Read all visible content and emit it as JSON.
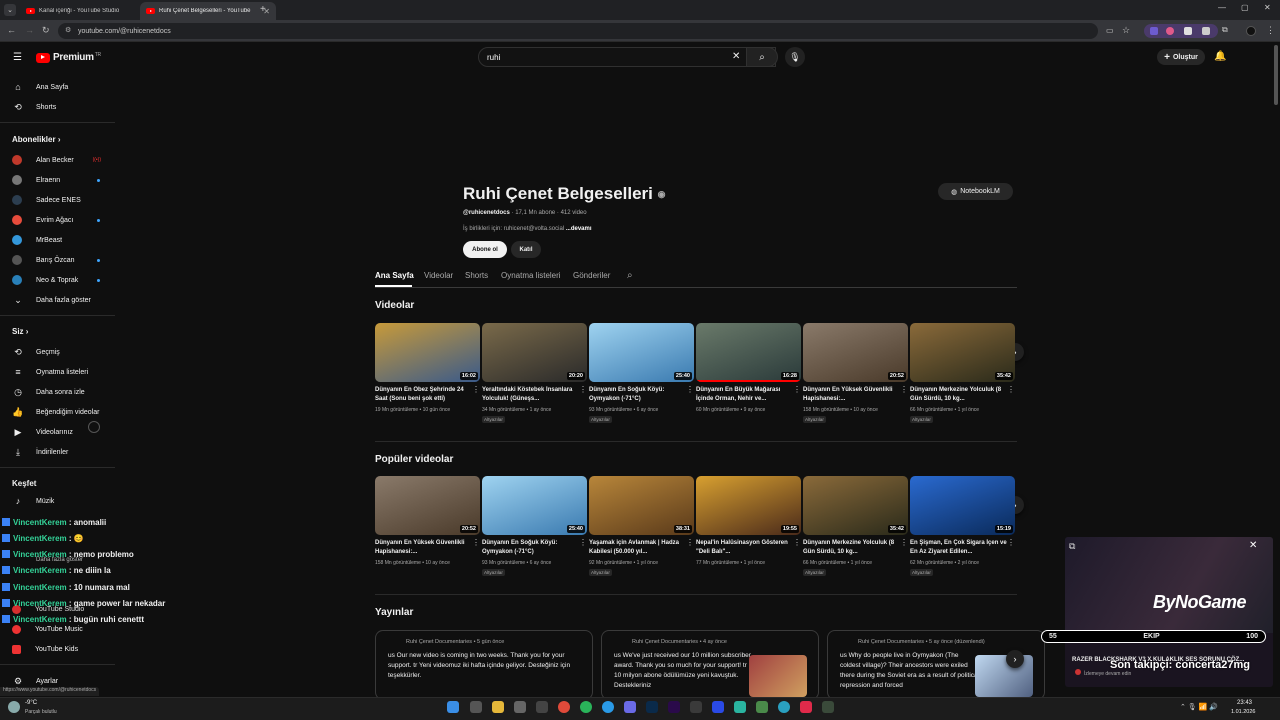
{
  "browser": {
    "tabs": [
      {
        "title": "Kanal içeriği - YouTube Studio"
      },
      {
        "title": "Ruhi Çenet Belgeselleri - YouTube"
      }
    ],
    "url": "youtube.com/@ruhicenetdocs"
  },
  "masthead": {
    "logo": "Premium",
    "region": "TR",
    "search_query": "ruhi",
    "create_label": "Oluştur"
  },
  "sidebar": {
    "main": [
      {
        "label": "Ana Sayfa",
        "icon": "home-icon"
      },
      {
        "label": "Shorts",
        "icon": "shorts-icon"
      }
    ],
    "subs_title": "Abonelikler",
    "subs": [
      {
        "label": "Alan Becker",
        "color": "#c0392b",
        "live": true
      },
      {
        "label": "Elraenn",
        "color": "#555555"
      },
      {
        "label": "Sadece ENES",
        "color": "#2c3e50"
      },
      {
        "label": "Evrim Ağacı",
        "color": "#e74c3c"
      },
      {
        "label": "MrBeast",
        "color": "#3498db"
      },
      {
        "label": "Barış Özcan",
        "color": "#444444"
      },
      {
        "label": "Neo & Toprak",
        "color": "#2980b9"
      }
    ],
    "more_subs": "Daha fazla göster",
    "you_title": "Siz",
    "you": [
      {
        "label": "Geçmiş",
        "icon": "history-icon"
      },
      {
        "label": "Oynatma listeleri",
        "icon": "playlist-icon"
      },
      {
        "label": "Daha sonra izle",
        "icon": "watch-later-icon"
      },
      {
        "label": "Beğendiğim videolar",
        "icon": "like-icon"
      },
      {
        "label": "Videolarınız",
        "icon": "your-videos-icon"
      },
      {
        "label": "İndirilenler",
        "icon": "download-icon"
      }
    ],
    "explore_title": "Keşfet",
    "explore": [
      {
        "label": "Müzik",
        "icon": "music-icon"
      }
    ],
    "more_from": [
      {
        "label": "YouTube Studio"
      },
      {
        "label": "YouTube Music"
      },
      {
        "label": "YouTube Kids"
      }
    ],
    "settings": "Ayarlar",
    "hidden_more": "Daha fazla göster"
  },
  "channel": {
    "name": "Ruhi Çenet Belgeselleri",
    "handle": "@ruhicenetdocs",
    "stats": "· 17,1 Mn abone · 412 video",
    "desc": "İş birlikleri için: ruhicenet@volta.social",
    "more": "...devamı",
    "subscribe": "Abone ol",
    "join": "Katıl",
    "notebook": "NotebookLM",
    "tabs": [
      "Ana Sayfa",
      "Videolar",
      "Shorts",
      "Oynatma listeleri",
      "Gönderiler"
    ]
  },
  "sections": {
    "videos": "Videolar",
    "popular": "Popüler videolar",
    "posts": "Yayınlar"
  },
  "videos": [
    {
      "title": "Dünyanın En Obez Şehrinde 24 Saat (Sonu beni şok etti)",
      "meta": "19 Mn görüntüleme • 10 gün önce",
      "dur": "16:02",
      "badge": "",
      "c1": "#c79a3a",
      "c2": "#3a5a8a",
      "progress": 0
    },
    {
      "title": "Yeraltındaki Köstebek İnsanlara Yolculuk! (Güneşs...",
      "meta": "34 Mn görüntüleme • 1 ay önce",
      "dur": "20:20",
      "badge": "Altyazılar",
      "c1": "#7a6a4a",
      "c2": "#2a2a2a",
      "progress": 0
    },
    {
      "title": "Dünyanın En Soğuk Köyü: Oymyakon (-71°C)",
      "meta": "93 Mn görüntüleme • 6 ay önce",
      "dur": "25:40",
      "badge": "Altyazılar",
      "c1": "#9fd3f0",
      "c2": "#3a7ab0",
      "progress": 0
    },
    {
      "title": "Dünyanın En Büyük Mağarası İçinde Orman, Nehir ve...",
      "meta": "60 Mn görüntüleme • 9 ay önce",
      "dur": "16:28",
      "badge": "",
      "c1": "#6a7a6a",
      "c2": "#2a3a3a",
      "progress": 100
    },
    {
      "title": "Dünyanın En Yüksek Güvenlikli Hapishanesi:...",
      "meta": "158 Mn görüntüleme • 10 ay önce",
      "dur": "20:52",
      "badge": "Altyazılar",
      "c1": "#8a7a6a",
      "c2": "#4a3a2a",
      "progress": 0
    },
    {
      "title": "Dünyanın Merkezine Yolculuk (8 Gün Sürdü, 10 kg...",
      "meta": "66 Mn görüntüleme • 1 yıl önce",
      "dur": "35:42",
      "badge": "Altyazılar",
      "c1": "#8a6a3a",
      "c2": "#2a2a1a",
      "progress": 0
    }
  ],
  "popular": [
    {
      "title": "Dünyanın En Yüksek Güvenlikli Hapishanesi:...",
      "meta": "158 Mn görüntüleme • 10 ay önce",
      "dur": "20:52",
      "badge": "",
      "c1": "#8a7a6a",
      "c2": "#4a3a2a",
      "progress": 0
    },
    {
      "title": "Dünyanın En Soğuk Köyü: Oymyakon (-71°C)",
      "meta": "93 Mn görüntüleme • 6 ay önce",
      "dur": "25:40",
      "badge": "Altyazılar",
      "c1": "#9fd3f0",
      "c2": "#3a7ab0",
      "progress": 0
    },
    {
      "title": "Yaşamak için Avlanmak | Hadza Kabilesi (50.000 yıl...",
      "meta": "92 Mn görüntüleme • 1 yıl önce",
      "dur": "38:31",
      "badge": "Altyazılar",
      "c1": "#b8863a",
      "c2": "#5a3a1a",
      "progress": 0
    },
    {
      "title": "Nepal'in Halüsinasyon Gösteren \"Deli Balı\"...",
      "meta": "77 Mn görüntüleme • 1 yıl önce",
      "dur": "19:55",
      "badge": "",
      "c1": "#d8a030",
      "c2": "#4a2a1a",
      "progress": 0
    },
    {
      "title": "Dünyanın Merkezine Yolculuk (8 Gün Sürdü, 10 kg...",
      "meta": "66 Mn görüntüleme • 1 yıl önce",
      "dur": "35:42",
      "badge": "Altyazılar",
      "c1": "#8a6a3a",
      "c2": "#2a2a1a",
      "progress": 0
    },
    {
      "title": "En Şişman, En Çok Sigara İçen ve En Az Ziyaret Edilen...",
      "meta": "62 Mn görüntüleme • 2 yıl önce",
      "dur": "15:19",
      "badge": "Altyazılar",
      "c1": "#2a6ad0",
      "c2": "#0a2a5a",
      "progress": 0
    }
  ],
  "posts": [
    {
      "author": "Ruhi Çenet Documentaries",
      "when": "5 gün önce",
      "text": "us Our new video is coming in two weeks. Thank you for your support. tr Yeni videomuz iki hafta içinde geliyor. Desteğiniz için teşekkürler."
    },
    {
      "author": "Ruhi Çenet Documentaries",
      "when": "4 ay önce",
      "text": "us We've just received our 10 million subscriber award. Thank you so much for your support! tr 10 milyon abone ödülümüze yeni kavuştuk. Destekleriniz"
    },
    {
      "author": "Ruhi Çenet Documentaries",
      "when": "5 ay önce (düzenlendi)",
      "text": "us Why do people live in Oymyakon (The coldest village)? Their ancestors were exiled there during the Soviet era as a result of political repression and forced"
    }
  ],
  "chat": [
    {
      "name": "VincentKerem",
      "msg": ": anomalii"
    },
    {
      "name": "VincentKerem",
      "msg": ": 😊"
    },
    {
      "name": "VincentKerem",
      "msg": ": nemo problemo"
    },
    {
      "name": "VincentKerem",
      "msg": ": ne diiin la"
    },
    {
      "name": "VincentKerem",
      "msg": ": 10 numara mal"
    },
    {
      "name": "VincentKerem",
      "msg": ": game power lar nekadar"
    },
    {
      "name": "VincentKerem",
      "msg": ": bugün ruhi cenettt"
    }
  ],
  "overlay": {
    "brand": "ByNoGame",
    "score_left": "55",
    "score_mid": "EKIP",
    "score_right": "100",
    "headline": "RAZER BLACKSHARK V3 X KULAKLIK SES SORUNU ÇÖZ...",
    "sub": "İzlemeye devam edin",
    "follower": "Son takipçi: concerta27mg"
  },
  "status": {
    "link": "https://www.youtube.com/@ruhicenetdocs"
  },
  "taskbar": {
    "weather_temp": "-9°C",
    "weather_desc": "Parçalı bulutlu",
    "time": "23:43",
    "date": "1.01.2026"
  }
}
